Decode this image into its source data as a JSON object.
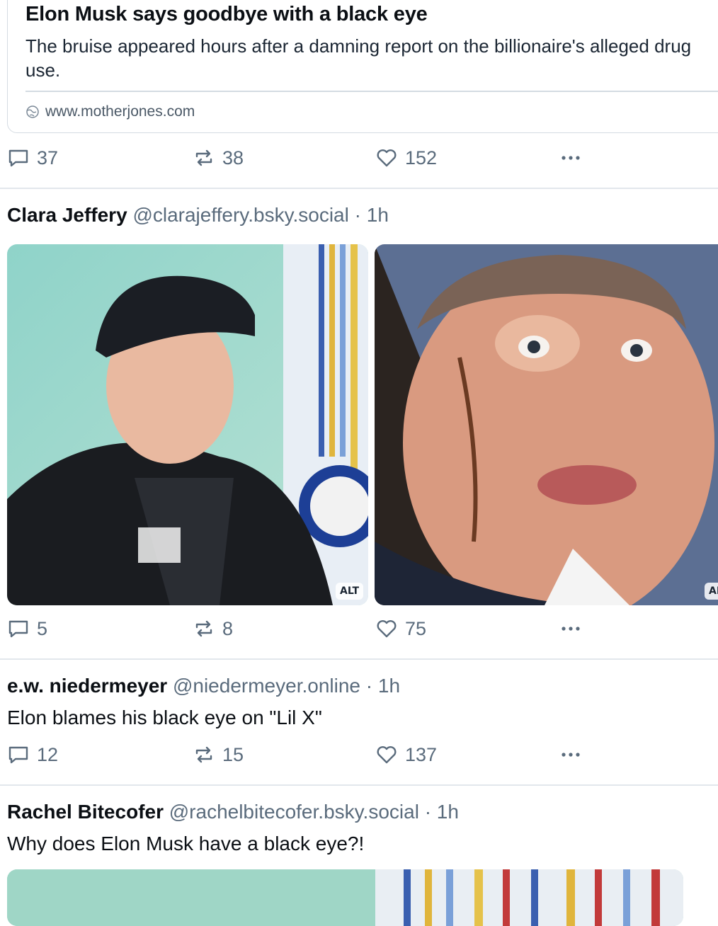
{
  "link_card": {
    "title": "Elon Musk says goodbye with a black eye",
    "description": "The bruise appeared hours after a damning report on the billionaire's alleged drug use.",
    "domain": "www.motherjones.com"
  },
  "post1_actions": {
    "replies": "37",
    "reposts": "38",
    "likes": "152"
  },
  "post2": {
    "author": "Clara Jeffery",
    "handle": "@clarajeffery.bsky.social",
    "time": "· 1h",
    "images": [
      {
        "alt_badge": "ALT"
      },
      {
        "alt_badge": "AL"
      }
    ],
    "actions": {
      "replies": "5",
      "reposts": "8",
      "likes": "75"
    }
  },
  "post3": {
    "author": "e.w. niedermeyer",
    "handle": "@niedermeyer.online",
    "time": "· 1h",
    "text": "Elon blames his black eye on \"Lil X\"",
    "actions": {
      "replies": "12",
      "reposts": "15",
      "likes": "137"
    }
  },
  "post4": {
    "author": "Rachel Bitecofer",
    "handle": "@rachelbitecofer.bsky.social",
    "time": "· 1h",
    "text": "Why does Elon Musk have a black eye?!"
  },
  "icons": [
    "reply-icon",
    "repost-icon",
    "like-icon",
    "more-icon",
    "globe-icon"
  ],
  "colors": {
    "muted": "#5a6b7c",
    "border": "#d4dbe2",
    "text": "#0b0f14"
  }
}
